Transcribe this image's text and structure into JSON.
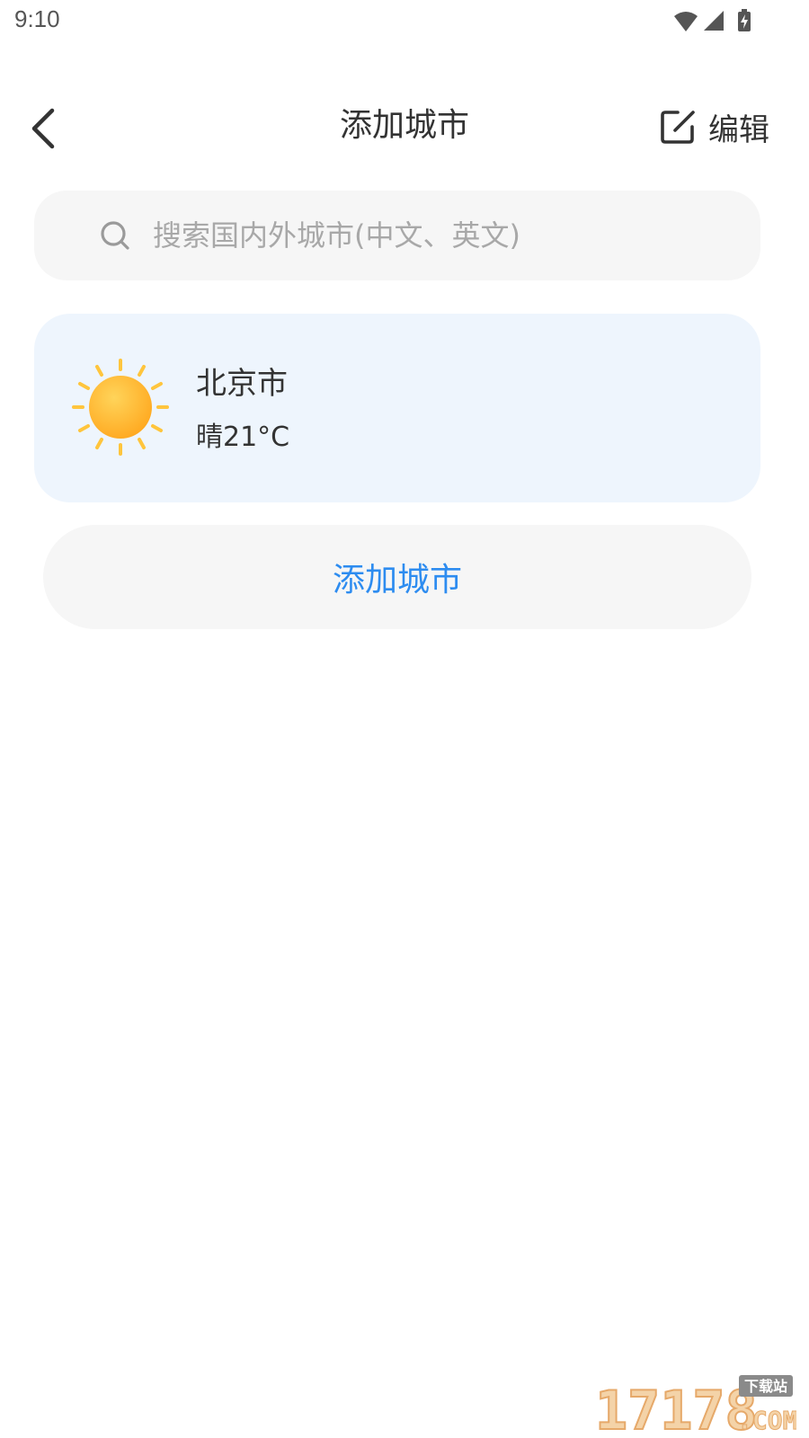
{
  "status_bar": {
    "time": "9:10",
    "icons": [
      "wifi-icon",
      "cellular-signal-icon",
      "battery-charging-icon"
    ]
  },
  "header": {
    "back_icon": "chevron-left-icon",
    "title": "添加城市",
    "edit_icon": "edit-square-icon",
    "edit_label": "编辑"
  },
  "search": {
    "icon": "search-icon",
    "placeholder": "搜索国内外城市(中文、英文)",
    "value": ""
  },
  "cities": [
    {
      "name": "北京市",
      "weather": "晴21°C",
      "weather_icon": "sunny-icon"
    }
  ],
  "add_city_button": {
    "label": "添加城市"
  },
  "watermark": {
    "text_main": "17178",
    "text_badge": "下载站",
    "text_suffix": ".COM"
  },
  "colors": {
    "accent": "#2d8cf0",
    "card_background": "#eef5fd",
    "field_background": "#f6f6f6",
    "sun_inner": "#ffc53d",
    "sun_outer": "#ffa81f"
  }
}
